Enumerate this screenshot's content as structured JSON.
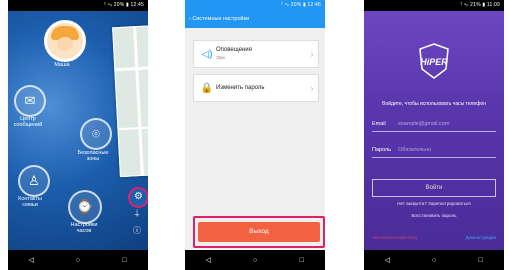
{
  "phone1": {
    "status": "ᵀ ⁹ᵢₗ 20% ▮ 12:45",
    "labels": {
      "masha": "Маша",
      "messages": "Центр сообщений",
      "safezones": "Безопасные зоны",
      "contacts": "Контакты семьи",
      "watchsettings": "Настройки часов"
    }
  },
  "phone2": {
    "status": "ᵀ ⁹ᵢₗ 20% ▮ 12:46",
    "header": "‹  Системные настройки",
    "rows": [
      {
        "label": "Оповещения",
        "sub": "Звук"
      },
      {
        "label": "Изменить пароль",
        "sub": ""
      }
    ],
    "exit": "Выход"
  },
  "phone3": {
    "status": "ᵀ ⁹ᵢₗ 21% ▮ 11:09",
    "logo_text": "HiPER",
    "subtitle": "Войдите, чтобы использовать часы телефон",
    "email_label": "Email",
    "email_placeholder": "example@gmail.com",
    "password_label": "Пароль",
    "password_placeholder": "Обязательно",
    "login": "Войти",
    "no_account": "Нет аккаунта? Зарегистрироваться",
    "restore": "Восстановить пароль",
    "foot_left": "Автоматический вход",
    "foot_right": "Демонстрация"
  },
  "nav": {
    "back": "◁",
    "home": "○",
    "recent": "□"
  },
  "colors": {
    "accent": "#2196f3",
    "highlight": "#e0216a",
    "exit": "#f26241",
    "login_bg": "#5a36ad"
  }
}
